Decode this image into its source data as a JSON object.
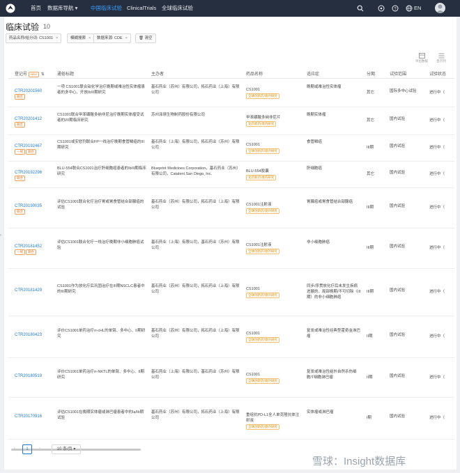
{
  "header": {
    "nav": [
      {
        "label": "首页"
      },
      {
        "label": "数据库导航 ▾"
      },
      {
        "label": "中国临床试验"
      },
      {
        "label": "ClinicalTrials"
      },
      {
        "label": "全球临床试验"
      }
    ],
    "lang": "EN"
  },
  "page": {
    "title": "临床试验",
    "count": "10"
  },
  "filters": [
    {
      "label": "药品名称/给分词: CS1001"
    },
    {
      "label": "模糊搜索"
    },
    {
      "label": "数据来源: CDE"
    },
    {
      "label": "清空"
    }
  ],
  "toolbar": {
    "export": "导出数据",
    "columns": "显示列"
  },
  "table": {
    "headers": {
      "reg": "登记号",
      "reg_badge": "NEW",
      "title": "通俗标题",
      "sponsor": "主办者",
      "drug": "药品名称",
      "indication": "适应症",
      "phase": "分期",
      "scope": "试验范围",
      "status": "试验状态"
    },
    "rows": [
      {
        "reg": "CTR20201560",
        "badges": [
          "联合"
        ],
        "title": "一项 CS1001联合铂化学治疗晚期或难治性实体瘤患者的多中心、开放Ib/II期研究",
        "sponsor": "基石药业（苏州）有限公司，拓石药业（上海）有限公司",
        "drug": "CS1001",
        "tag": "全球创新药/境外研究",
        "indication": "晚期或难治性实体瘤",
        "phase": "其它",
        "scope": "国际多中心试验",
        "status": "进行中（"
      },
      {
        "reg": "CTR20201412",
        "badges": [
          "联合"
        ],
        "title": "CS1001联合甲苯磺酸多纳非尼治疗晚期实体瘤受试者的I/II期临床研究",
        "sponsor": "苏州泽璟生物制药股份有限公司",
        "drug": "甲苯磺酸多纳非尼片",
        "tag": "化药新药/境内研究",
        "indication": "晚期实体瘤",
        "phase": "其它",
        "scope": "国内试验",
        "status": "进行中（"
      },
      {
        "reg": "CTR20192467",
        "badges": [
          "一线",
          "联合"
        ],
        "title": "CS1001或安慰剂联合FP一线治疗晚期食管鳞癌的III期研究",
        "sponsor": "基石药业（上海）有限公司，拓石药业（苏州）有限公司",
        "drug": "CS1001",
        "tag": "全球创新药/境外研究",
        "indication": "食管鳞癌",
        "phase": "III期",
        "scope": "国内试验",
        "status": "进行中（"
      },
      {
        "reg": "CTR20192296",
        "badges": [
          "联合"
        ],
        "title": "BLU-554联合CS1001治疗肝细胞癌患者的Ib/II期临床研究",
        "sponsor": "Blueprint Medicines Corporation，基石药业（苏州）有限公司，Catalent San Diego, Inc.",
        "drug": "BLU-554胶囊",
        "tag": "化药新药/境内研究",
        "indication": "肝细胞癌",
        "phase": "其它",
        "scope": "国内试验",
        "status": "进行中（"
      },
      {
        "reg": "CTR20190035",
        "badges": [
          "联合"
        ],
        "title": "评估CS1001联合化疗治疗胃或胃食管结合部腺癌的试验",
        "sponsor": "基石药业（苏州）有限公司，拓石药业（上海）有限公司",
        "drug": "CS1001注射液",
        "tag": "全球创新药/境外研究",
        "indication": "胃腺癌或胃食管结合部腺癌",
        "phase": "III期",
        "scope": "国内试验",
        "status": "进行中（"
      },
      {
        "reg": "CTR20181452",
        "badges": [
          "一线",
          "联合"
        ],
        "title": "评估CS1001联合化疗一线治疗晚期非小细胞肺癌试验",
        "sponsor": "基石药业（上海）有限公司，基石药业（苏州）有限公司",
        "drug": "CS1001注射液",
        "tag": "全球创新药/境外研究",
        "indication": "非小细胞肺癌",
        "phase": "III期",
        "scope": "国内试验",
        "status": "进行中（"
      },
      {
        "reg": "CTR20181429",
        "badges": [],
        "title": "CS1001作为放化疗后巩固治疗在III期NSCLC患者中的III期研究",
        "sponsor": "基石药业（苏州）有限公司，拓石药业（上海）有限公司",
        "drug": "CS1001",
        "tag": "全球创新药/境外研究",
        "indication": "同步/序贯放化疗后未发生疾病进展的、局部晚期/不可切除（III期）的非小细胞肺癌",
        "phase": "III期",
        "scope": "国内试验",
        "status": "进行中（"
      },
      {
        "reg": "CTR20180423",
        "badges": [],
        "title": "评价CS1001单药治疗rr-cHL的单臂、多中心、II期研究",
        "sponsor": "基石药业（苏州）有限公司，拓石药业（上海）有限公司",
        "drug": "CS1001",
        "tag": "全球创新药/境外研究",
        "indication": "复发或难治性经典型霍奇金淋巴瘤",
        "phase": "II期",
        "scope": "国内试验",
        "status": "进行中（"
      },
      {
        "reg": "CTR20180519",
        "badges": [],
        "title": "评价CS1001单药治疗rr-NKTL的单臂、多中心、II期研究",
        "sponsor": "基石药业（上海）有限公司，基石药业（苏州）有限公司",
        "drug": "CS1001",
        "tag": "全球创新药/境外研究",
        "indication": "复发或难治性结外自然杀伤细胞/T细胞淋巴瘤",
        "phase": "II期",
        "scope": "国内试验",
        "status": "进行中（"
      },
      {
        "reg": "CTR20170916",
        "badges": [],
        "title": "评估CS1001在晚期实体瘤或淋巴瘤患者中的Ia/Ib期试验",
        "sponsor": "基石药业（苏州）有限公司，拓石药业（上海）有限公司",
        "drug": "重组抗PD-L1全人单克隆抗体注射液",
        "tag": "全球创新药/境外研究",
        "indication": "实体瘤或淋巴瘤",
        "phase": "I期",
        "scope": "国内试验",
        "status": "进行中（"
      }
    ]
  },
  "pagination": {
    "prev": "‹",
    "current": "1",
    "next": "›",
    "page_size": "10 条/页 ▾"
  },
  "watermark": "雪球：Insight数据库",
  "colors": {
    "topbar": "#252f3f",
    "accent": "#1f79d8",
    "active_nav": "#3aa0ff",
    "badge": "#e07b22"
  }
}
